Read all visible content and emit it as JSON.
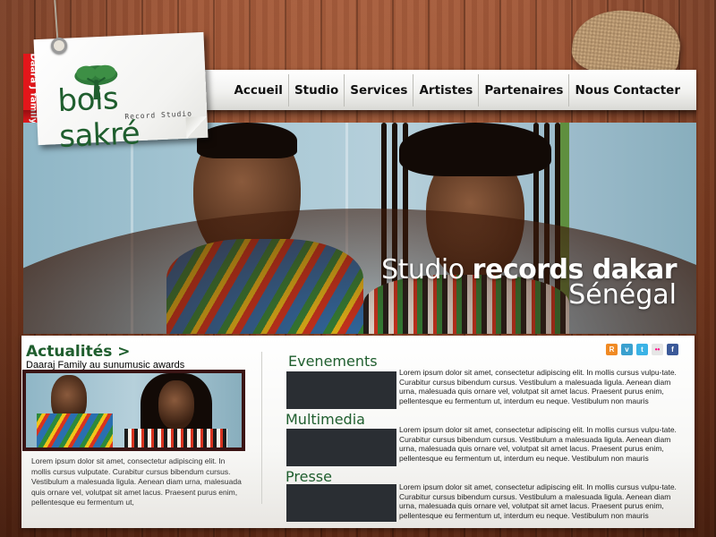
{
  "side_tab": {
    "label": "Daara J family"
  },
  "logo": {
    "name": "bois sakré",
    "subtitle": "Record Studio"
  },
  "nav": {
    "items": [
      {
        "label": "Accueil"
      },
      {
        "label": "Studio"
      },
      {
        "label": "Services"
      },
      {
        "label": "Artistes"
      },
      {
        "label": "Partenaires"
      },
      {
        "label": "Nous Contacter"
      }
    ]
  },
  "hero": {
    "line1_regular": "Studio",
    "line1_bold": "records dakar",
    "line2": "Sénégal"
  },
  "news": {
    "title": "Actualités >",
    "subtitle": "Daaraj Family au sunumusic awards",
    "text": "Lorem ipsum dolor sit amet, consectetur adipiscing elit. In mollis cursus vulputate. Curabitur cursus bibendum cursus. Vestibulum a malesuada ligula. Aenean diam urna, malesuada quis ornare vel, volutpat sit amet lacus. Praesent purus enim, pellentesque eu fermentum ut,"
  },
  "social_icons": [
    {
      "icon": "rss-icon",
      "glyph": "R",
      "color": "#f08a24"
    },
    {
      "icon": "vimeo-icon",
      "glyph": "v",
      "color": "#3aa0cf"
    },
    {
      "icon": "twitter-icon",
      "glyph": "t",
      "color": "#3bb3e6"
    },
    {
      "icon": "flickr-icon",
      "glyph": "••",
      "color": "#dddddd"
    },
    {
      "icon": "facebook-icon",
      "glyph": "f",
      "color": "#3b5998"
    }
  ],
  "sections": [
    {
      "title": "Evenements",
      "text": "Lorem ipsum dolor sit amet, consectetur adipiscing elit. In mollis cursus vulpu-tate. Curabitur cursus bibendum cursus. Vestibulum a malesuada ligula. Aenean diam urna, malesuada quis ornare vel, volutpat sit amet lacus. Praesent purus enim, pellentesque eu fermentum ut, interdum eu neque. Vestibulum non mauris"
    },
    {
      "title": "Multimedia",
      "text": "Lorem ipsum dolor sit amet, consectetur adipiscing elit. In mollis cursus vulpu-tate. Curabitur cursus bibendum cursus. Vestibulum a malesuada ligula. Aenean diam urna, malesuada quis ornare vel, volutpat sit amet lacus. Praesent purus enim, pellentesque eu fermentum ut, interdum eu neque. Vestibulum non mauris"
    },
    {
      "title": "Presse",
      "text": "Lorem ipsum dolor sit amet, consectetur adipiscing elit. In mollis cursus vulpu-tate. Curabitur cursus bibendum cursus. Vestibulum a malesuada ligula. Aenean diam urna, malesuada quis ornare vel, volutpat sit amet lacus. Praesent purus enim, pellentesque eu fermentum ut, interdum eu neque. Vestibulum non mauris"
    }
  ],
  "colors": {
    "brand_green": "#1f5e2e",
    "accent_red": "#e3161a",
    "wood": "#8a4426"
  }
}
